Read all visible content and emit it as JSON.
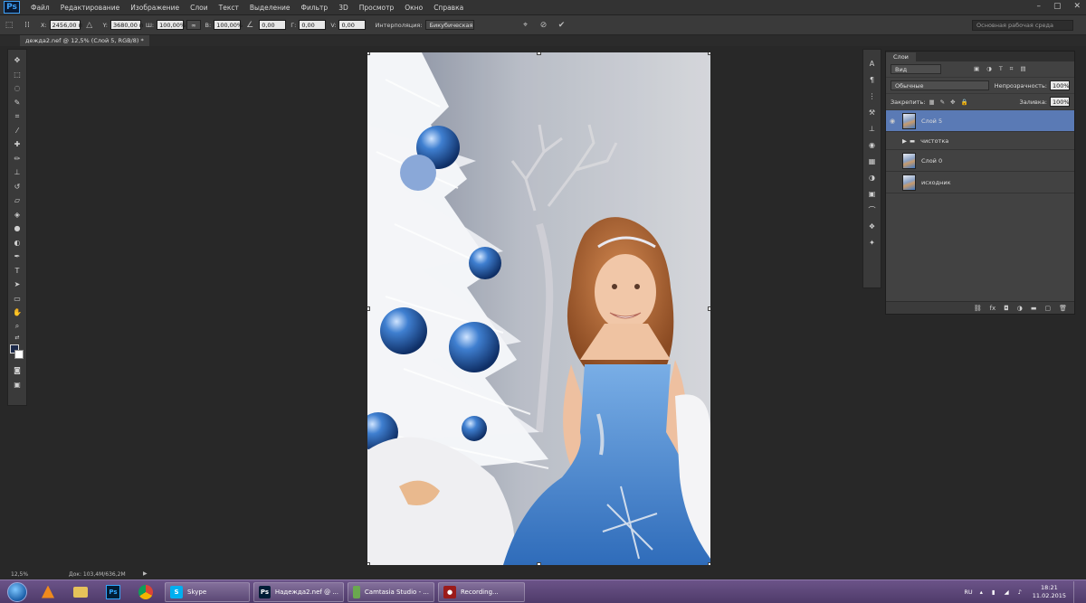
{
  "app": {
    "logo": "Ps"
  },
  "menu": [
    "Файл",
    "Редактирование",
    "Изображение",
    "Слои",
    "Текст",
    "Выделение",
    "Фильтр",
    "3D",
    "Просмотр",
    "Окно",
    "Справка"
  ],
  "window_controls": [
    "–",
    "▢",
    "✕"
  ],
  "options": {
    "x_label": "X:",
    "x_value": "2456,00 п",
    "y_label": "Y:",
    "y_value": "3680,00 п",
    "w_label": "Ш:",
    "w_value": "100,00%",
    "link_label": "∞",
    "h_label": "В:",
    "h_value": "100,00%",
    "angle_value": "0,00",
    "hskew_label": "Г:",
    "hskew_value": "0,00",
    "vskew_label": "V:",
    "vskew_value": "0,00",
    "interp_label": "Интерполяция:",
    "interp_value": "Бикубическая",
    "workspace": "Основная рабочая среда"
  },
  "document": {
    "tab": "дежда2.nef @ 12,5% (Слой 5, RGB/8) *"
  },
  "layers_panel": {
    "title": "Слои",
    "filter": "Вид",
    "blend_mode": "Обычные",
    "opacity_label": "Непрозрачность:",
    "opacity_value": "100%",
    "lock_label": "Закрепить:",
    "fill_label": "Заливка:",
    "fill_value": "100%",
    "layers": [
      {
        "name": "Слой 5",
        "selected": true,
        "visible": true
      },
      {
        "name": "чистотка",
        "group": true
      },
      {
        "name": "Слой 0"
      },
      {
        "name": "исходник"
      }
    ]
  },
  "status": {
    "zoom": "12,5%",
    "doc": "Док: 103,4M/636,2M"
  },
  "taskbar": {
    "items": [
      {
        "label": "Skype",
        "color": "#00aff0",
        "glyph": "S"
      },
      {
        "label": "Надежда2.nef @ ...",
        "color": "#001e36",
        "glyph": "Ps"
      },
      {
        "label": "Camtasia Studio - ...",
        "color": "#6aa84f",
        "glyph": ""
      },
      {
        "label": "Recording...",
        "color": "#9b1b1b",
        "glyph": "●"
      }
    ],
    "lang": "RU",
    "time": "18:21",
    "date": "11.02.2015"
  }
}
